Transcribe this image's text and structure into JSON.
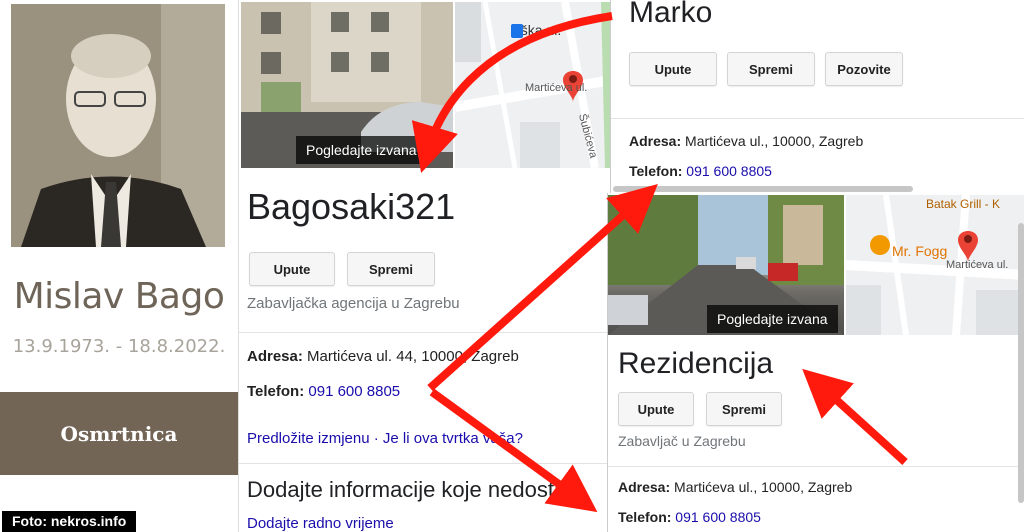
{
  "memorial": {
    "name": "Mislav Bago",
    "dates": "13.9.1973. - 18.8.2022.",
    "button": "Osmrtnica",
    "credit": "Foto: nekros.info"
  },
  "panel_left": {
    "map_street_top": "aška ul.",
    "map_street": "Martićeva ul.",
    "map_street_side": "Šubićeva",
    "streetview_label": "Pogledajte izvana",
    "title": "Bagosaki321",
    "buttons": [
      "Upute",
      "Spremi"
    ],
    "category": "Zabavljačka agencija u Zagrebu",
    "address_label": "Adresa:",
    "address_value": "Martićeva ul. 44, 10000, Zagreb",
    "phone_label": "Telefon:",
    "phone_value": "091 600 8805",
    "suggest_edit": "Predložite izmjenu",
    "separator": "·",
    "own_business": "Je li ova tvrtka vaša?",
    "add_info_heading": "Dodajte informacije koje nedostaju",
    "add_hours": "Dodajte radno vrijeme"
  },
  "panel_top_right": {
    "title": "Marko",
    "buttons": [
      "Upute",
      "Spremi",
      "Pozovite"
    ],
    "address_label": "Adresa:",
    "address_value": "Martićeva ul., 10000, Zagreb",
    "phone_label": "Telefon:",
    "phone_value": "091 600 8805"
  },
  "panel_bottom_right": {
    "map_place_top": "Batak Grill - K",
    "map_place": "Mr. Fogg",
    "map_street": "Martićeva ul.",
    "streetview_label": "Pogledajte izvana",
    "title": "Rezidencija",
    "buttons": [
      "Upute",
      "Spremi"
    ],
    "category": "Zabavljač u Zagrebu",
    "address_label": "Adresa:",
    "address_value": "Martićeva ul., 10000, Zagreb",
    "phone_label": "Telefon:",
    "phone_value": "091 600 8805"
  },
  "colors": {
    "arrow": "#ff1a0d",
    "link": "#1a0dab",
    "memorial_button": "#736556",
    "map_pin": "#ea4335"
  }
}
